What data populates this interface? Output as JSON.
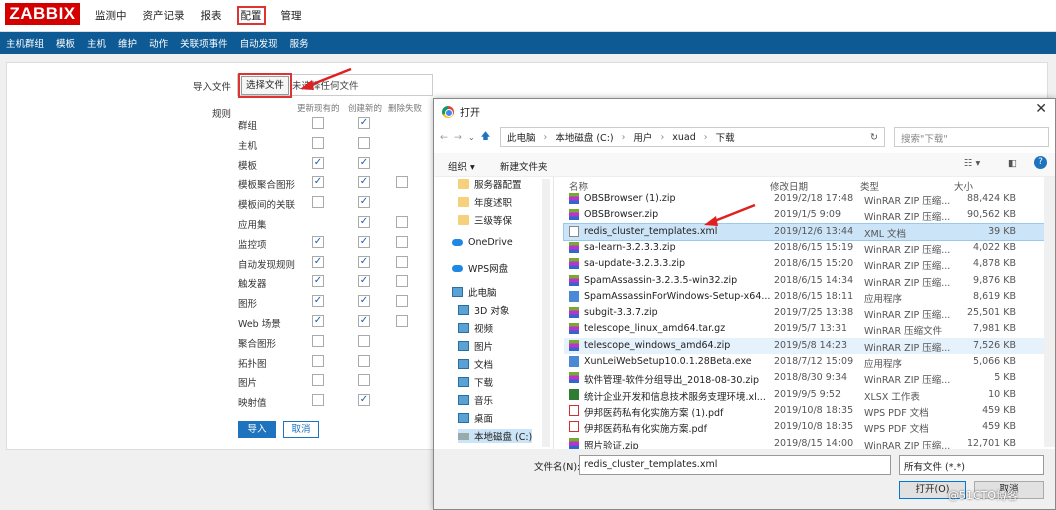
{
  "topbar": {
    "logo": "ZABBIX",
    "nav": [
      "监测中",
      "资产记录",
      "报表",
      "配置",
      "管理"
    ]
  },
  "subnav": [
    "主机群组",
    "模板",
    "主机",
    "维护",
    "动作",
    "关联项事件",
    "自动发现",
    "服务"
  ],
  "import_form": {
    "file_label": "导入文件",
    "choose_button": "选择文件",
    "no_file": "未选择任何文件",
    "rules_label": "规则",
    "col_update": "更新现有的",
    "col_create": "创建新的",
    "col_delete": "删除失败",
    "rules": [
      {
        "label": "群组",
        "update": false,
        "create": true,
        "delete": null
      },
      {
        "label": "主机",
        "update": false,
        "create": false,
        "delete": null
      },
      {
        "label": "模板",
        "update": true,
        "create": true,
        "delete": null
      },
      {
        "label": "模板聚合图形",
        "update": true,
        "create": true,
        "delete": false
      },
      {
        "label": "模板间的关联",
        "update": false,
        "create": true,
        "delete": null
      },
      {
        "label": "应用集",
        "update": null,
        "create": true,
        "delete": false
      },
      {
        "label": "监控项",
        "update": true,
        "create": true,
        "delete": false
      },
      {
        "label": "自动发现规则",
        "update": true,
        "create": true,
        "delete": false
      },
      {
        "label": "触发器",
        "update": true,
        "create": true,
        "delete": false
      },
      {
        "label": "图形",
        "update": true,
        "create": true,
        "delete": false
      },
      {
        "label": "Web 场景",
        "update": true,
        "create": true,
        "delete": false
      },
      {
        "label": "聚合图形",
        "update": false,
        "create": false,
        "delete": null
      },
      {
        "label": "拓扑图",
        "update": false,
        "create": false,
        "delete": null
      },
      {
        "label": "图片",
        "update": false,
        "create": false,
        "delete": null
      },
      {
        "label": "映射值",
        "update": false,
        "create": true,
        "delete": null
      }
    ],
    "import_button": "导入",
    "cancel_button": "取消"
  },
  "dialog": {
    "title": "打开",
    "path": [
      "此电脑",
      "本地磁盘 (C:)",
      "用户",
      "xuad",
      "下载"
    ],
    "search_placeholder": "搜索\"下载\"",
    "organize": "组织 ▾",
    "new_folder": "新建文件夹",
    "nav_items": [
      {
        "label": "服务器配置",
        "icon": "folder-icon"
      },
      {
        "label": "年度述职",
        "icon": "folder-icon"
      },
      {
        "label": "三级等保",
        "icon": "folder-icon"
      },
      {
        "label": "OneDrive",
        "icon": "cloud-icon"
      },
      {
        "label": "WPS网盘",
        "icon": "cloud-icon"
      },
      {
        "label": "此电脑",
        "icon": "computer-icon"
      },
      {
        "label": "3D 对象",
        "icon": "3d-icon"
      },
      {
        "label": "视频",
        "icon": "video-icon"
      },
      {
        "label": "图片",
        "icon": "picture-icon"
      },
      {
        "label": "文档",
        "icon": "document-icon"
      },
      {
        "label": "下载",
        "icon": "download-icon"
      },
      {
        "label": "音乐",
        "icon": "music-icon"
      },
      {
        "label": "桌面",
        "icon": "desktop-icon"
      },
      {
        "label": "本地磁盘 (C:)",
        "icon": "disk-icon"
      }
    ],
    "columns": [
      "名称",
      "修改日期",
      "类型",
      "大小"
    ],
    "files": [
      {
        "name": "OBSBrowser (1).zip",
        "date": "2019/2/18 17:48",
        "type": "WinRAR ZIP 压缩...",
        "size": "88,424 KB",
        "icon": "zip"
      },
      {
        "name": "OBSBrowser.zip",
        "date": "2019/1/5 9:09",
        "type": "WinRAR ZIP 压缩...",
        "size": "90,562 KB",
        "icon": "zip"
      },
      {
        "name": "redis_cluster_templates.xml",
        "date": "2019/12/6 13:44",
        "type": "XML 文档",
        "size": "39 KB",
        "icon": "xml"
      },
      {
        "name": "sa-learn-3.2.3.3.zip",
        "date": "2018/6/15 15:19",
        "type": "WinRAR ZIP 压缩...",
        "size": "4,022 KB",
        "icon": "zip"
      },
      {
        "name": "sa-update-3.2.3.3.zip",
        "date": "2018/6/15 15:20",
        "type": "WinRAR ZIP 压缩...",
        "size": "4,878 KB",
        "icon": "zip"
      },
      {
        "name": "SpamAssassin-3.2.3.5-win32.zip",
        "date": "2018/6/15 14:34",
        "type": "WinRAR ZIP 压缩...",
        "size": "9,876 KB",
        "icon": "zip"
      },
      {
        "name": "SpamAssassinForWindows-Setup-x64...",
        "date": "2018/6/15 18:11",
        "type": "应用程序",
        "size": "8,619 KB",
        "icon": "exe"
      },
      {
        "name": "subgit-3.3.7.zip",
        "date": "2019/7/25 13:38",
        "type": "WinRAR ZIP 压缩...",
        "size": "25,501 KB",
        "icon": "zip"
      },
      {
        "name": "telescope_linux_amd64.tar.gz",
        "date": "2019/5/7 13:31",
        "type": "WinRAR 压缩文件",
        "size": "7,981 KB",
        "icon": "zip"
      },
      {
        "name": "telescope_windows_amd64.zip",
        "date": "2019/5/8 14:23",
        "type": "WinRAR ZIP 压缩...",
        "size": "7,526 KB",
        "icon": "zip"
      },
      {
        "name": "XunLeiWebSetup10.0.1.28Beta.exe",
        "date": "2018/7/12 15:09",
        "type": "应用程序",
        "size": "5,066 KB",
        "icon": "exe"
      },
      {
        "name": "软件管理-软件分组导出_2018-08-30.zip",
        "date": "2018/8/30 9:34",
        "type": "WinRAR ZIP 压缩...",
        "size": "5 KB",
        "icon": "zip"
      },
      {
        "name": "统计企业开发和信息技术服务支理环境.xl...",
        "date": "2019/9/5 9:52",
        "type": "XLSX 工作表",
        "size": "10 KB",
        "icon": "xlsx"
      },
      {
        "name": "伊邦医药私有化实施方案 (1).pdf",
        "date": "2019/10/8 18:35",
        "type": "WPS PDF 文档",
        "size": "459 KB",
        "icon": "pdf"
      },
      {
        "name": "伊邦医药私有化实施方案.pdf",
        "date": "2019/10/8 18:35",
        "type": "WPS PDF 文档",
        "size": "459 KB",
        "icon": "pdf"
      },
      {
        "name": "照片验证.zip",
        "date": "2019/8/15 14:00",
        "type": "WinRAR ZIP 压缩...",
        "size": "12,701 KB",
        "icon": "zip"
      }
    ],
    "filename_label": "文件名(N):",
    "filename_value": "redis_cluster_templates.xml",
    "filetype_value": "所有文件 (*.*)",
    "open_button": "打开(O)",
    "cancel_button": "取消"
  },
  "watermark": "@51CTO博客"
}
